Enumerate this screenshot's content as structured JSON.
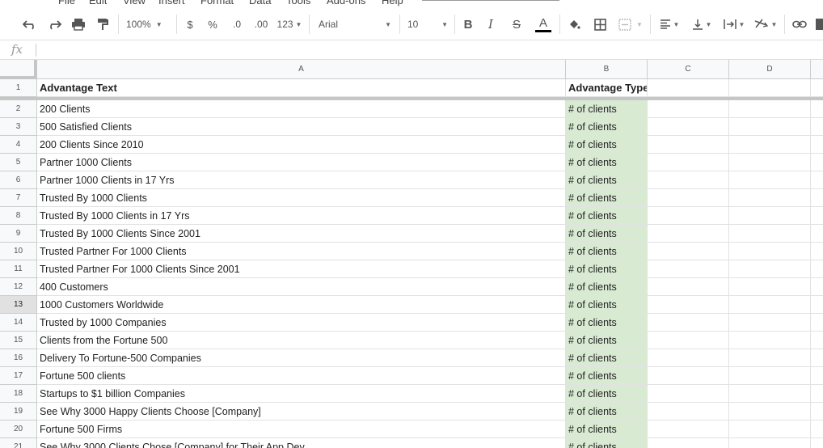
{
  "menu": [
    "File",
    "Edit",
    "View",
    "Insert",
    "Format",
    "Data",
    "Tools",
    "Add-ons",
    "Help"
  ],
  "toolbar": {
    "zoom": "100%",
    "currency": "$",
    "percent": "%",
    "decrease_decimal": ".0",
    "increase_decimal": ".00",
    "more_formats": "123",
    "font": "Arial",
    "font_size": "10",
    "bold": "B",
    "italic": "I",
    "strike": "S",
    "text_color_glyph": "A",
    "text_color": "#000000"
  },
  "formula_bar": {
    "fx_label": "fx",
    "value": ""
  },
  "columns": [
    "A",
    "B",
    "C",
    "D"
  ],
  "rows": [
    {
      "num": "1",
      "a": "Advantage Text",
      "b": "Advantage Type"
    },
    {
      "num": "2",
      "a": "200 Clients",
      "b": "# of clients"
    },
    {
      "num": "3",
      "a": "500 Satisfied Clients",
      "b": "# of clients"
    },
    {
      "num": "4",
      "a": "200 Clients Since 2010",
      "b": "# of clients"
    },
    {
      "num": "5",
      "a": "Partner 1000 Clients",
      "b": "# of clients"
    },
    {
      "num": "6",
      "a": "Partner 1000 Clients in 17 Yrs",
      "b": "# of clients"
    },
    {
      "num": "7",
      "a": "Trusted By 1000 Clients",
      "b": "# of clients"
    },
    {
      "num": "8",
      "a": "Trusted By 1000 Clients in 17 Yrs",
      "b": "# of clients"
    },
    {
      "num": "9",
      "a": "Trusted By 1000 Clients Since 2001",
      "b": "# of clients"
    },
    {
      "num": "10",
      "a": "Trusted Partner For 1000 Clients",
      "b": "# of clients"
    },
    {
      "num": "11",
      "a": "Trusted Partner For 1000 Clients Since 2001",
      "b": "# of clients"
    },
    {
      "num": "12",
      "a": "400 Customers",
      "b": "# of clients"
    },
    {
      "num": "13",
      "a": "1000 Customers Worldwide",
      "b": "# of clients"
    },
    {
      "num": "14",
      "a": "Trusted by 1000 Companies",
      "b": "# of clients"
    },
    {
      "num": "15",
      "a": "Clients from the Fortune 500",
      "b": "# of clients"
    },
    {
      "num": "16",
      "a": "Delivery To Fortune-500 Companies",
      "b": "# of clients"
    },
    {
      "num": "17",
      "a": "Fortune 500 clients",
      "b": "# of clients"
    },
    {
      "num": "18",
      "a": "Startups to $1 billion Companies",
      "b": "# of clients"
    },
    {
      "num": "19",
      "a": "See Why 3000 Happy Clients Choose [Company]",
      "b": "# of clients"
    },
    {
      "num": "20",
      "a": "Fortune 500 Firms",
      "b": "# of clients"
    },
    {
      "num": "21",
      "a": "See Why 3000 Clients Chose [Company] for Their App Dev",
      "b": "# of clients"
    }
  ],
  "active_row": "13",
  "colors": {
    "type_fill": "#d9ead3",
    "header_bg": "#f8f9fa",
    "freeze": "#c4c7c5"
  }
}
